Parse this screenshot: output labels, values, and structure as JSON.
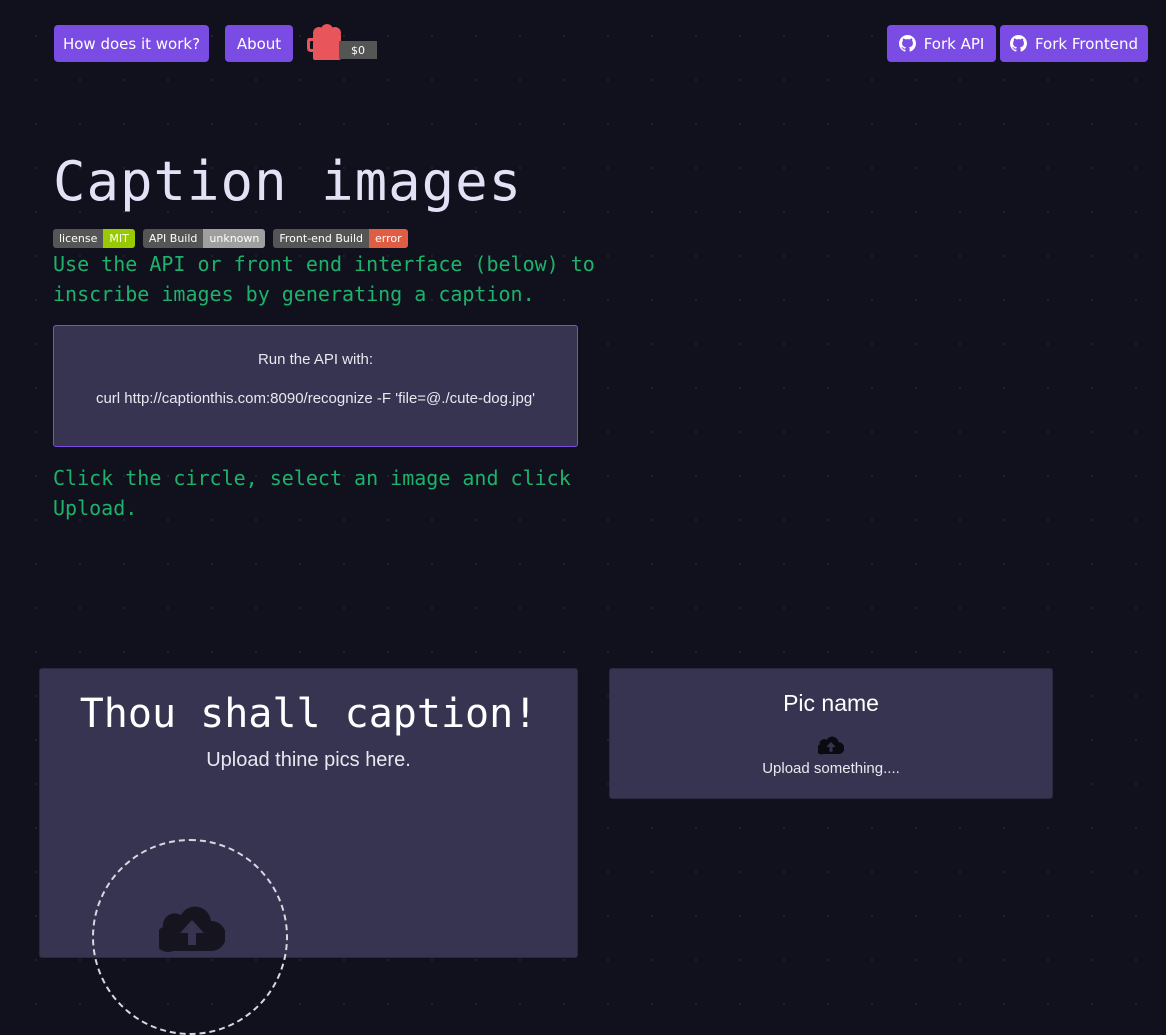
{
  "nav": {
    "how_label": "How does it work?",
    "about_label": "About",
    "coffee_amount": "$0",
    "fork_api_label": "Fork API",
    "fork_frontend_label": "Fork Frontend",
    "accent_color": "#7b4ce3"
  },
  "hero": {
    "title": "Caption images",
    "badges": [
      {
        "left": "license",
        "right": "MIT",
        "color": "#97ca00"
      },
      {
        "left": "API Build",
        "right": "unknown",
        "color": "#9f9f9f"
      },
      {
        "left": "Front-end Build",
        "right": "error",
        "color": "#e05d44"
      }
    ],
    "intro": "Use the API or front end interface (below) to inscribe images by generating a caption.",
    "api_box": {
      "label": "Run the API with:",
      "command": "curl http://captionthis.com:8090/recognize -F 'file=@./cute-dog.jpg'"
    },
    "instructions": "Click the circle, select an image and click Upload."
  },
  "upload": {
    "title": "Thou shall caption!",
    "subtitle": "Upload thine pics here.",
    "icon": "cloud-upload-icon"
  },
  "result": {
    "pic_name": "Pic name",
    "status": "Upload something...."
  }
}
